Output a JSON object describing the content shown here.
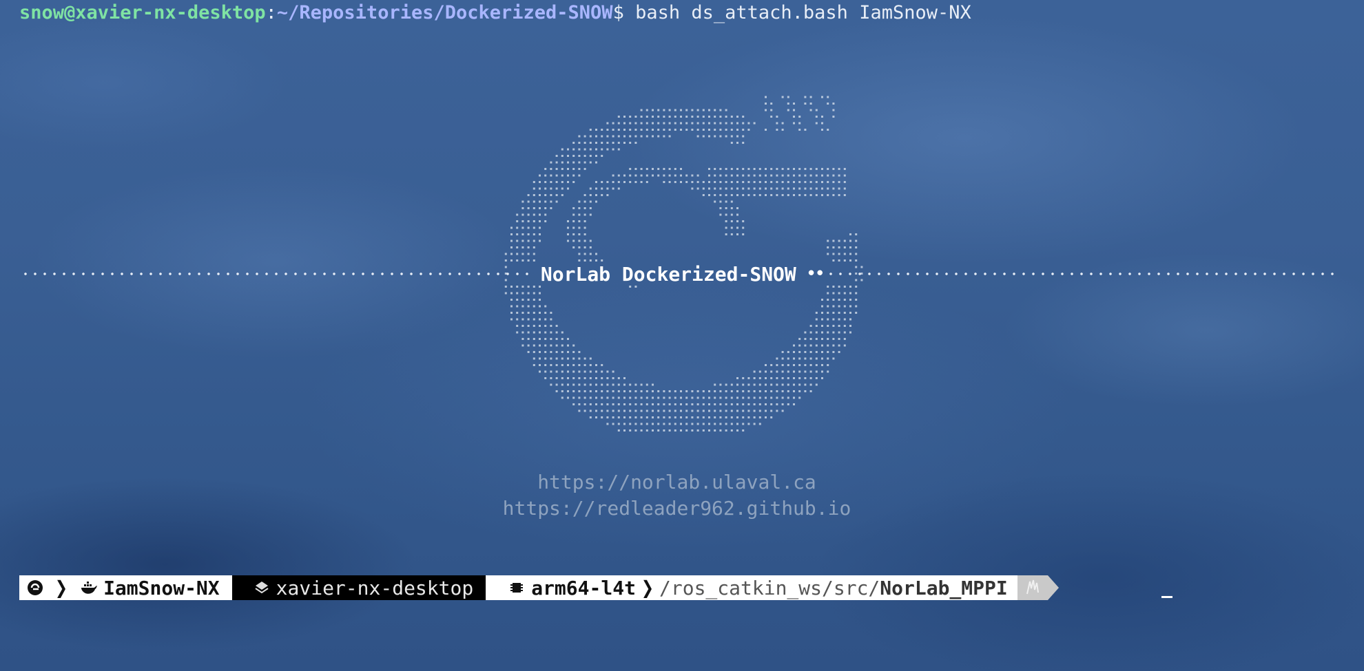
{
  "terminal": {
    "prompt_user_host": "snow@xavier-nx-desktop",
    "prompt_colon": ":",
    "prompt_path": "~/Repositories/Dockerized-SNOW",
    "prompt_symbol": "$",
    "command": " bash ds_attach.bash IamSnow-NX"
  },
  "banner": {
    "title": "NorLab Dockerized-SNOW",
    "right_bullets": "••"
  },
  "links": {
    "url_1": "https://norlab.ulaval.ca",
    "url_2": "https://redleader962.github.io"
  },
  "status_bar": {
    "container_name": "IamSnow-NX",
    "host_name": "xavier-nx-desktop",
    "arch": "arm64-l4t",
    "path_prefix": "/ros_catkin_ws/src/",
    "path_current": "NorLab_MPPI"
  },
  "icons": {
    "logo": "norlab-logo-icon",
    "docker": "docker-whale-icon",
    "host": "layers-icon",
    "arch": "chip-icon"
  },
  "colors": {
    "background": "#3a5f94",
    "prompt_user": "#7fe3a3",
    "prompt_path": "#a9b6ff",
    "url": "#9eb0c8"
  }
}
